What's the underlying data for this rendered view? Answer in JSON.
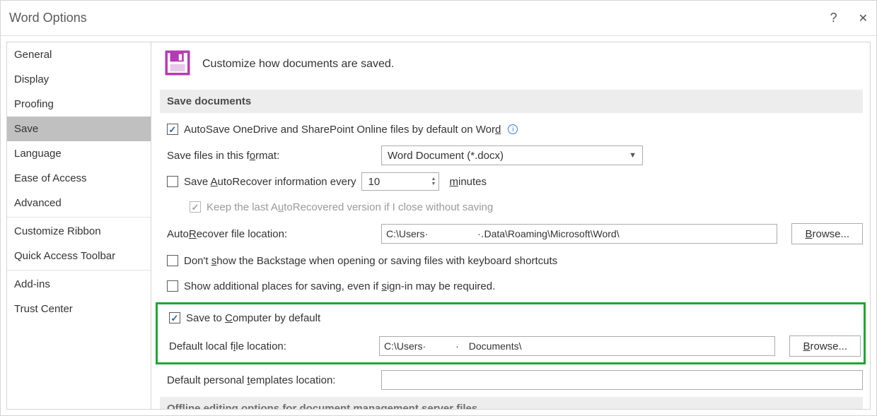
{
  "window": {
    "title": "Word Options"
  },
  "sidebar": {
    "items": [
      {
        "label": "General"
      },
      {
        "label": "Display"
      },
      {
        "label": "Proofing"
      },
      {
        "label": "Save",
        "selected": true
      },
      {
        "label": "Language"
      },
      {
        "label": "Ease of Access"
      },
      {
        "label": "Advanced"
      },
      {
        "label": "Customize Ribbon"
      },
      {
        "label": "Quick Access Toolbar"
      },
      {
        "label": "Add-ins"
      },
      {
        "label": "Trust Center"
      }
    ]
  },
  "main": {
    "header": "Customize how documents are saved.",
    "section_title": "Save documents",
    "autosave_label_pre": "AutoSave OneDrive and SharePoint Online files by default on Wor",
    "autosave_label_accel": "d",
    "format_label_pre": "Save files in this f",
    "format_label_accel": "o",
    "format_label_post": "rmat:",
    "format_value": "Word Document (*.docx)",
    "autorecover_label_pre": "Save ",
    "autorecover_label_accel": "A",
    "autorecover_label_post": "utoRecover information every",
    "autorecover_value": "10",
    "minutes_accel": "m",
    "minutes_post": "inutes",
    "keep_last_pre": "Keep the last A",
    "keep_last_accel": "u",
    "keep_last_post": "toRecovered version if I close without saving",
    "ar_loc_label_pre": "Auto",
    "ar_loc_label_accel": "R",
    "ar_loc_label_post": "ecover file location:",
    "ar_loc_value": "C:\\Users·     ·․Data\\Roaming\\Microsoft\\Word\\",
    "browse_accel": "B",
    "browse_post": "rowse...",
    "dont_show_pre": "Don't ",
    "dont_show_accel": "s",
    "dont_show_post": "how the Backstage when opening or saving files with keyboard shortcuts",
    "add_places_pre": "Show additional places for saving, even if ",
    "add_places_accel": "s",
    "add_places_post": "ign-in may be required.",
    "save_comp_pre": "Save to ",
    "save_comp_accel": "C",
    "save_comp_post": "omputer by default",
    "def_local_pre": "Default local f",
    "def_local_accel": "i",
    "def_local_post": "le location:",
    "def_local_value": "C:\\Users·   · Documents\\",
    "def_tmpl_pre": "Default personal ",
    "def_tmpl_accel": "t",
    "def_tmpl_post": "emplates location:",
    "def_tmpl_value": "",
    "cutoff_title": "Offline editing options for document management server files"
  }
}
